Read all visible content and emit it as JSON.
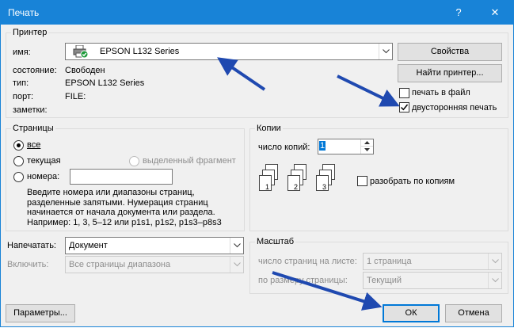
{
  "window": {
    "title": "Печать",
    "help_glyph": "?",
    "close_glyph": "✕"
  },
  "printer": {
    "group_label": "Принтер",
    "name_label": "имя:",
    "name_value": "EPSON L132 Series",
    "status_label": "состояние:",
    "status_value": "Свободен",
    "type_label": "тип:",
    "type_value": "EPSON L132 Series",
    "port_label": "порт:",
    "port_value": "FILE:",
    "notes_label": "заметки:",
    "properties_button": "Свойства",
    "find_printer_button": "Найти принтер...",
    "print_to_file_label": "печать в файл",
    "print_to_file_checked": false,
    "duplex_label": "двусторонняя печать",
    "duplex_checked": true
  },
  "pages": {
    "group_label": "Страницы",
    "all_label": "все",
    "current_label": "текущая",
    "selection_label": "выделенный фрагмент",
    "numbers_label": "номера:",
    "numbers_value": "",
    "selected": "all",
    "hint": "Введите номера или диапазоны страниц, разделенные запятыми. Нумерация страниц начинается от начала документа или раздела. Например: 1, 3, 5–12 или p1s1, p1s2, p1s3–p8s3"
  },
  "copies": {
    "group_label": "Копии",
    "count_label": "число копий:",
    "count_value": "1",
    "collate_label": "разобрать по копиям",
    "collate_checked": false,
    "stack_numbers": [
      "1",
      "2",
      "3"
    ]
  },
  "print_what": {
    "label": "Напечатать:",
    "value": "Документ"
  },
  "include": {
    "label": "Включить:",
    "value": "Все страницы диапазона"
  },
  "zoom": {
    "group_label": "Масштаб",
    "pages_per_sheet_label": "число страниц на листе:",
    "pages_per_sheet_value": "1 страница",
    "scale_to_label": "по размеру страницы:",
    "scale_to_value": "Текущий"
  },
  "footer": {
    "options_button": "Параметры...",
    "ok_button": "ОК",
    "cancel_button": "Отмена"
  },
  "colors": {
    "titlebar": "#1883d7",
    "annotation_arrow": "#1f49b0",
    "focus_border": "#0078d7"
  },
  "icons": {
    "printer": "printer-ready-icon",
    "annotation": "blue-arrow-icon"
  }
}
